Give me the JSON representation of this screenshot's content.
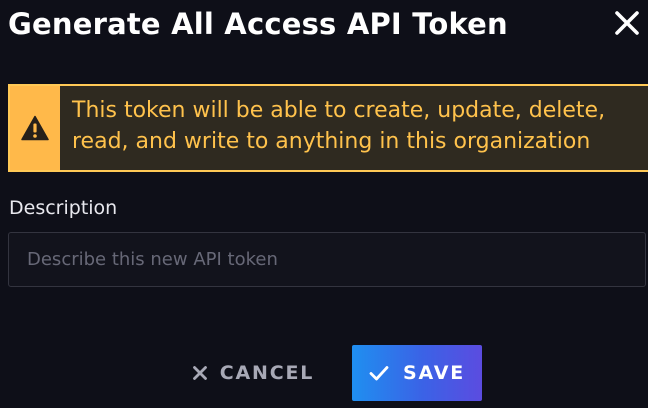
{
  "dialog": {
    "title": "Generate All Access API Token",
    "close_icon": "close-icon"
  },
  "alert": {
    "icon": "warning-icon",
    "line1": "This token will be able to create, update, delete,",
    "line2": "read, and write to anything in this organization",
    "colors": {
      "accent": "#ffb94a",
      "text": "#ffc24c",
      "background": "#2f2a20"
    }
  },
  "description": {
    "label": "Description",
    "placeholder": "Describe this new API token",
    "value": ""
  },
  "actions": {
    "cancel_label": "CANCEL",
    "cancel_icon": "close-icon",
    "save_label": "SAVE",
    "save_icon": "check-icon",
    "save_gradient": [
      "#1f8ff0",
      "#5b4ce0"
    ]
  }
}
